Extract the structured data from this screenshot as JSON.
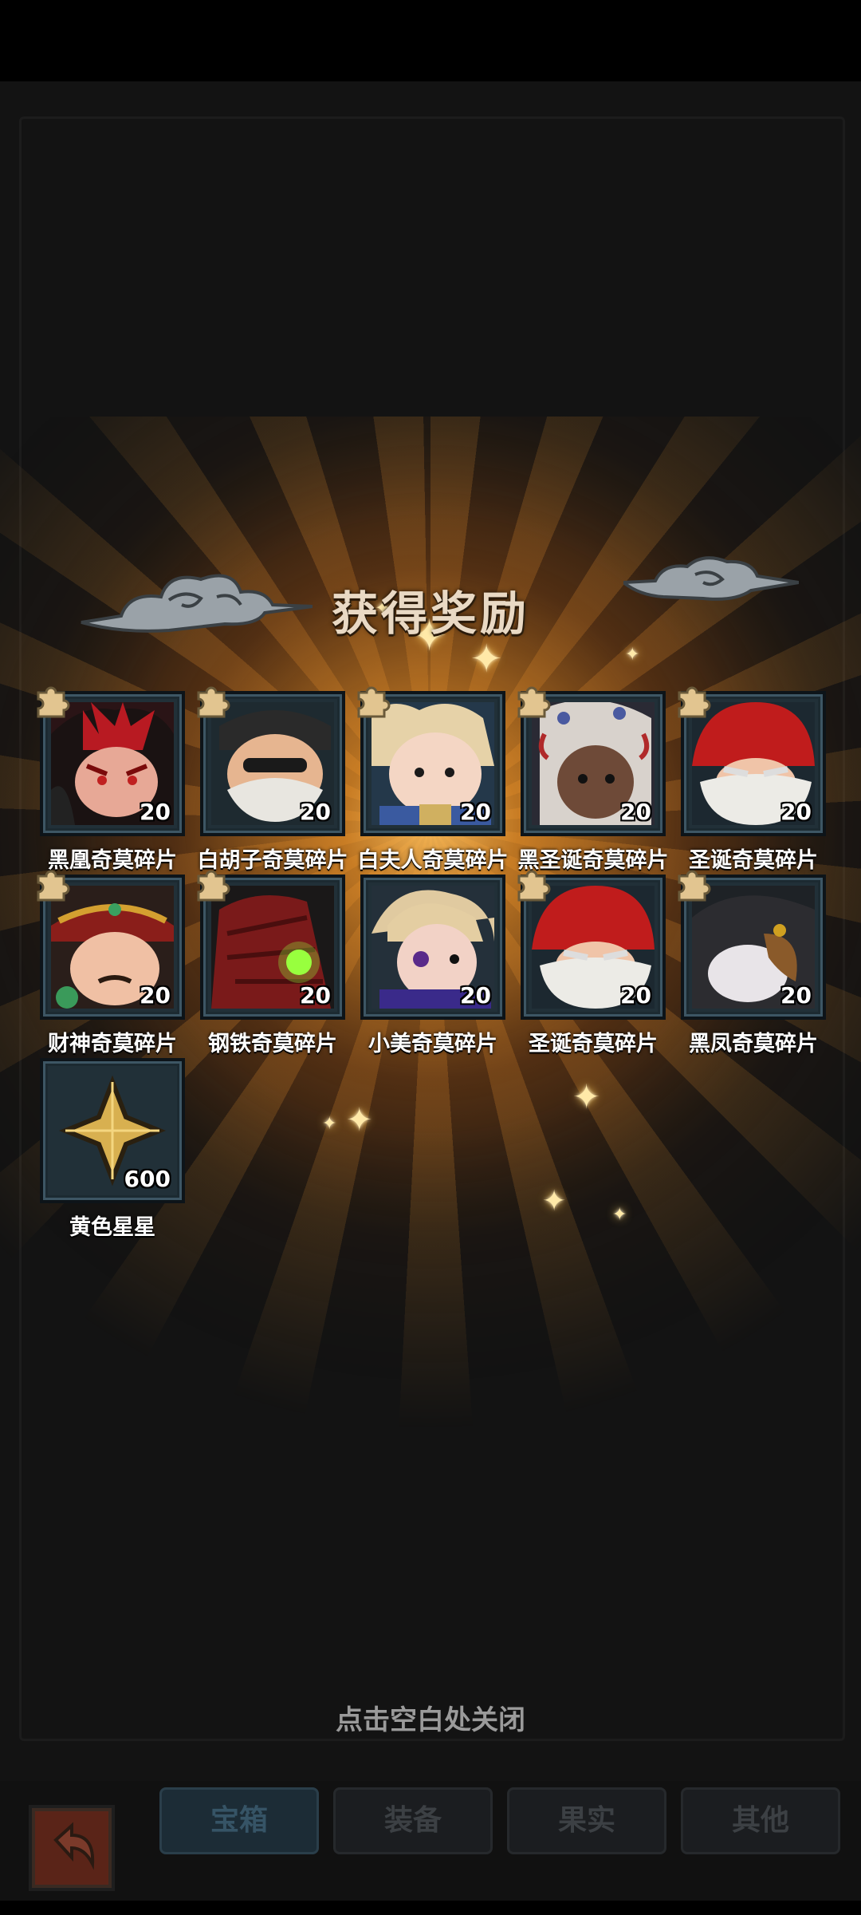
{
  "title": "获得奖励",
  "close_hint": "点击空白处关闭",
  "rewards": [
    {
      "name": "黑凰奇莫碎片",
      "count": "20",
      "icon": "black-phoenix-portrait-icon"
    },
    {
      "name": "白胡子奇莫碎片",
      "count": "20",
      "icon": "white-beard-portrait-icon"
    },
    {
      "name": "白夫人奇莫碎片",
      "count": "20",
      "icon": "white-lady-portrait-icon"
    },
    {
      "name": "黑圣诞奇莫碎片",
      "count": "20",
      "icon": "black-christmas-portrait-icon"
    },
    {
      "name": "圣诞奇莫碎片",
      "count": "20",
      "icon": "santa-portrait-icon"
    },
    {
      "name": "财神奇莫碎片",
      "count": "20",
      "icon": "fortune-god-portrait-icon"
    },
    {
      "name": "钢铁奇莫碎片",
      "count": "20",
      "icon": "iron-armor-portrait-icon"
    },
    {
      "name": "小美奇莫碎片",
      "count": "20",
      "icon": "xiaomei-portrait-icon"
    },
    {
      "name": "圣诞奇莫碎片",
      "count": "20",
      "icon": "santa-portrait-icon"
    },
    {
      "name": "黑凤奇莫碎片",
      "count": "20",
      "icon": "black-bird-portrait-icon"
    },
    {
      "name": "黄色星星",
      "count": "600",
      "icon": "yellow-star-icon"
    }
  ],
  "tabs": [
    "宝箱",
    "装备",
    "果实",
    "其他"
  ],
  "active_tab": "宝箱",
  "colors": {
    "accent_orange": "#f5a030",
    "card_frame": "#3d5664",
    "label_text": "#ffffff"
  }
}
